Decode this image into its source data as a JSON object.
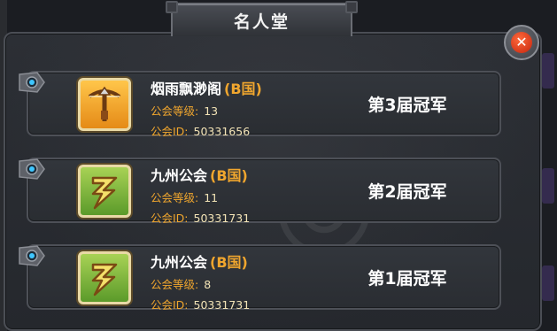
{
  "title": "名人堂",
  "close_icon_glyph": "✕",
  "accent_color": "#f0a62e",
  "rows": [
    {
      "icon": "crossbow-icon",
      "icon_color": "orange",
      "guild_name": "烟雨飘渺阁",
      "country": "(B国)",
      "level_label": "公会等级:",
      "level_value": "13",
      "id_label": "公会ID:",
      "id_value": "50331656",
      "champion": "第3届冠军"
    },
    {
      "icon": "lightning-icon",
      "icon_color": "green",
      "guild_name": "九州公会",
      "country": "(B国)",
      "level_label": "公会等级:",
      "level_value": "11",
      "id_label": "公会ID:",
      "id_value": "50331731",
      "champion": "第2届冠军"
    },
    {
      "icon": "lightning-icon",
      "icon_color": "green",
      "guild_name": "九州公会",
      "country": "(B国)",
      "level_label": "公会等级:",
      "level_value": "8",
      "id_label": "公会ID:",
      "id_value": "50331731",
      "champion": "第1届冠军"
    }
  ]
}
